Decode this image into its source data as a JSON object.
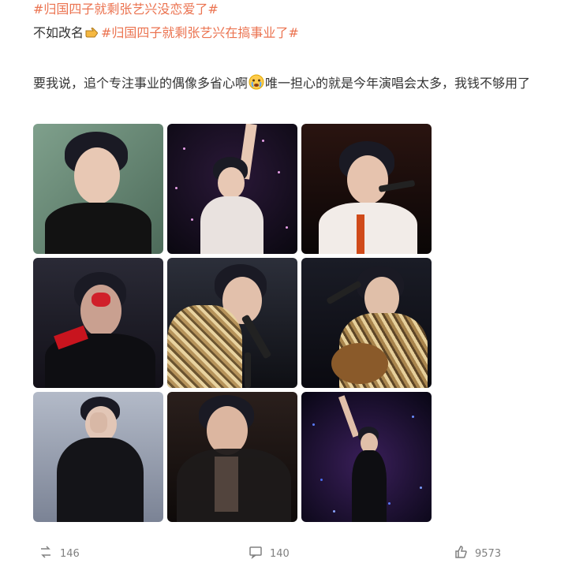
{
  "post": {
    "topic_tag": "#归国四子就剩张艺兴没恋爱了#",
    "rename_prefix": "不如改名",
    "rename_emoji": "pointing-hand-icon",
    "rename_tag": "#归国四子就剩张艺兴在搞事业了#",
    "body_before_emoji": "要我说，追个专注事业的偶像多省心啊",
    "body_emoji": "crying-face-icon",
    "body_after_emoji": "唯一担心的就是今年演唱会太多，我钱不够用了"
  },
  "images": [
    {
      "id": "photo-1",
      "bg": "#6d8f7c"
    },
    {
      "id": "photo-2",
      "bg": "#120e1c"
    },
    {
      "id": "photo-3",
      "bg": "#1a0c0a"
    },
    {
      "id": "photo-4",
      "bg": "#1c1a22"
    },
    {
      "id": "photo-5",
      "bg": "#1a1c24"
    },
    {
      "id": "photo-6",
      "bg": "#14151c"
    },
    {
      "id": "photo-7",
      "bg": "#9aa2b4"
    },
    {
      "id": "photo-8",
      "bg": "#1a1514"
    },
    {
      "id": "photo-9",
      "bg": "#150f24"
    }
  ],
  "actions": {
    "repost_count": "146",
    "comment_count": "140",
    "like_count": "9573"
  },
  "colors": {
    "hashtag": "#eb7350",
    "text": "#333333",
    "meta": "#808080"
  }
}
